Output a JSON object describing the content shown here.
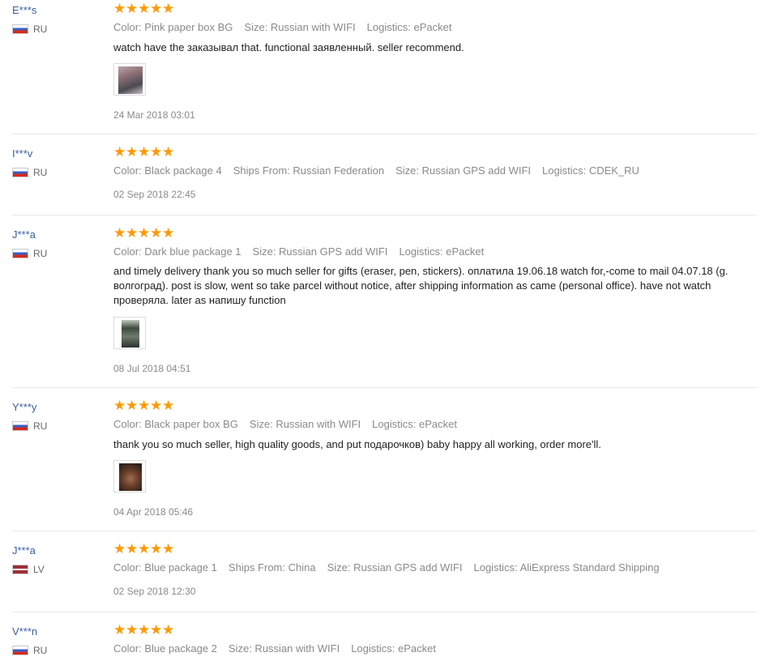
{
  "reviews": [
    {
      "user": "E***s",
      "country": "RU",
      "flag": "ru",
      "attrs": [
        "Color: Pink paper box BG",
        "Size: Russian with WIFI",
        "Logistics: ePacket"
      ],
      "text": "watch have the заказывал that. functional заявленный. seller recommend.",
      "has_photo": true,
      "photo_colors": [
        "#8c6f75",
        "#4a4a52",
        "#b9a3a8"
      ],
      "date": "24 Mar 2018 03:01",
      "stars": 5
    },
    {
      "user": "I***v",
      "country": "RU",
      "flag": "ru",
      "attrs": [
        "Color: Black package 4",
        "Ships From: Russian Federation",
        "Size: Russian GPS add WIFI",
        "Logistics: CDEK_RU"
      ],
      "text": "",
      "has_photo": false,
      "date": "02 Sep 2018 22:45",
      "stars": 5
    },
    {
      "user": "J***a",
      "country": "RU",
      "flag": "ru",
      "attrs": [
        "Color: Dark blue package 1",
        "Size: Russian GPS add WIFI",
        "Logistics: ePacket"
      ],
      "text": "and timely delivery thank you so much seller for gifts (eraser, pen, stickers). оплатила 19.06.18 watch for,-come to mail 04.07.18 (g. волгоград). post is slow, went so take parcel without notice, after shipping information as came (personal office). have not watch проверяла. later as напишу function",
      "has_photo": true,
      "photo_colors": [
        "#3d4a3f",
        "#6f7a6c",
        "#c2c6be"
      ],
      "date": "08 Jul 2018 04:51",
      "stars": 5
    },
    {
      "user": "Y***y",
      "country": "RU",
      "flag": "ru",
      "attrs": [
        "Color: Black paper box BG",
        "Size: Russian with WIFI",
        "Logistics: ePacket"
      ],
      "text": "thank you so much seller, high quality goods, and put подарочков) baby happy all working, order more'll.",
      "has_photo": true,
      "photo_colors": [
        "#6b3f2a",
        "#a0704f",
        "#2e211c"
      ],
      "date": "04 Apr 2018 05:46",
      "stars": 5
    },
    {
      "user": "J***a",
      "country": "LV",
      "flag": "lv",
      "attrs": [
        "Color: Blue package 1",
        "Ships From: China",
        "Size: Russian GPS add WIFI",
        "Logistics: AliExpress Standard Shipping"
      ],
      "text": "",
      "has_photo": false,
      "date": "02 Sep 2018 12:30",
      "stars": 5
    },
    {
      "user": "V***n",
      "country": "RU",
      "flag": "ru",
      "attrs": [
        "Color: Blue package 2",
        "Size: Russian with WIFI",
        "Logistics: ePacket"
      ],
      "text": "",
      "has_photo": false,
      "date": "",
      "stars": 5
    }
  ],
  "colors": {
    "star": "#ff9900",
    "username": "#3a5f9e",
    "meta": "#8a8a8a"
  }
}
